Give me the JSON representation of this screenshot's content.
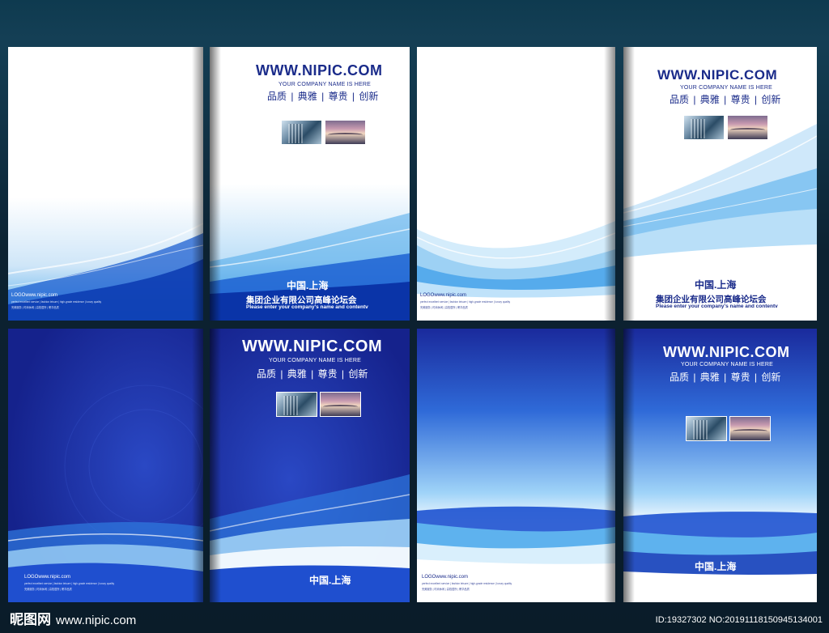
{
  "site": "WWW.NIPIC.COM",
  "company_en": "YOUR COMPANY NAME IS HERE",
  "slogan": "品质 | 典雅 | 尊贵 | 创新",
  "city": "中国.上海",
  "company_cn": "集团企业有限公司高峰论坛会",
  "tagline": "Please enter your company's name and contentv",
  "back_logo": "LOGOwww.nipic.com",
  "back_small_line1": "perfect excellent service | fashion leisure | high-grade residence | luxury quality",
  "back_small_line2": "完美服务 | 时尚休闲 | 高档居所 | 奢华品质",
  "watermark": {
    "brand": "昵图网",
    "url": "www.nipic.com",
    "id": "ID:19327302 NO:20191118150945134001"
  },
  "colors": {
    "navy": "#1a2b8a",
    "deep_blue": "#1a2a9c",
    "light_blue": "#5aaee8"
  }
}
